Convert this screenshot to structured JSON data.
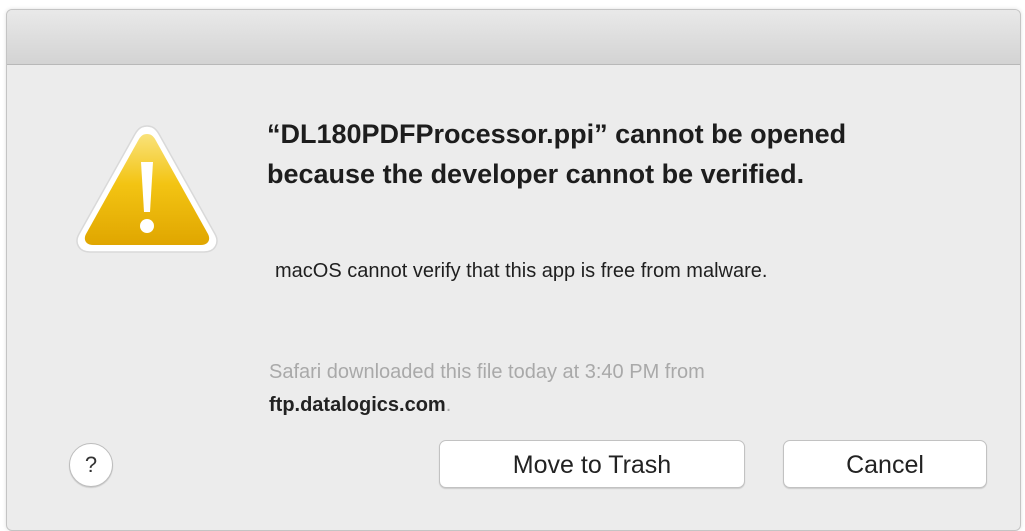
{
  "dialog": {
    "icon": "warning-triangle-icon",
    "headline": "“DL180PDFProcessor.ppi” cannot be opened because the developer cannot be verified.",
    "message": "macOS cannot verify that this app is free from malware.",
    "source_prefix": "Safari downloaded this file today at 3:40 PM from",
    "source_domain": "ftp.datalogics.com",
    "source_suffix": ".",
    "help_label": "?",
    "buttons": {
      "move_to_trash": "Move to Trash",
      "cancel": "Cancel"
    }
  },
  "colors": {
    "dialog_bg": "#ececec",
    "warning_yellow": "#f3c20e",
    "secondary_text": "#a9a9a9"
  }
}
